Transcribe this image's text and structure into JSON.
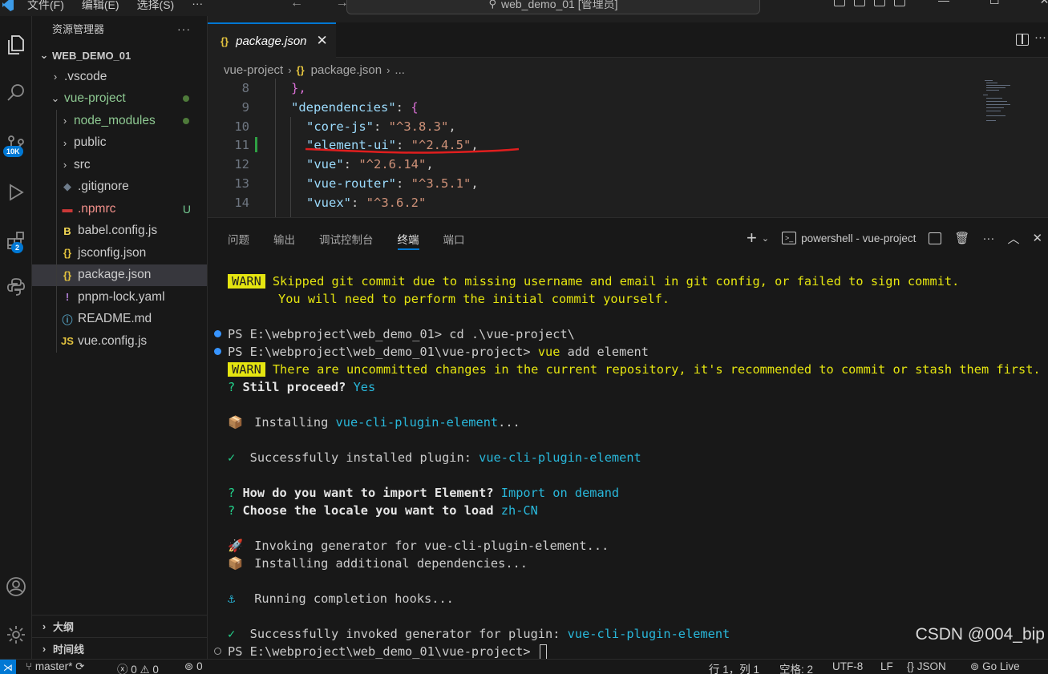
{
  "titlebar": {
    "menu": [
      "文件(F)",
      "编辑(E)",
      "选择(S)",
      "···"
    ],
    "nav": "← →",
    "search_text": "web_demo_01 [管理员]"
  },
  "activitybar": {
    "scm_badge": "10K",
    "extensions_badge": "2"
  },
  "sidebar": {
    "title": "资源管理器",
    "more": "···",
    "workspace": "WEB_DEMO_01",
    "tree": [
      {
        "label": ".vscode",
        "type": "folder",
        "depth": 1,
        "expanded": false
      },
      {
        "label": "vue-project",
        "type": "folder",
        "depth": 1,
        "expanded": true,
        "status": "dot"
      },
      {
        "label": "node_modules",
        "type": "folder",
        "depth": 2,
        "expanded": false,
        "status": "dot"
      },
      {
        "label": "public",
        "type": "folder",
        "depth": 2,
        "expanded": false
      },
      {
        "label": "src",
        "type": "folder",
        "depth": 2,
        "expanded": false
      },
      {
        "label": ".gitignore",
        "type": "file",
        "icon": "git-icon",
        "depth": 2
      },
      {
        "label": ".npmrc",
        "type": "file",
        "icon": "npm-icon",
        "depth": 2,
        "status": "U"
      },
      {
        "label": "babel.config.js",
        "type": "file",
        "icon": "babel-icon",
        "depth": 2
      },
      {
        "label": "jsconfig.json",
        "type": "file",
        "icon": "json-icon",
        "depth": 2
      },
      {
        "label": "package.json",
        "type": "file",
        "icon": "json-icon",
        "depth": 2,
        "selected": true
      },
      {
        "label": "pnpm-lock.yaml",
        "type": "file",
        "icon": "yaml-icon",
        "depth": 2
      },
      {
        "label": "README.md",
        "type": "file",
        "icon": "info-icon",
        "depth": 2
      },
      {
        "label": "vue.config.js",
        "type": "file",
        "icon": "js-icon",
        "depth": 2
      }
    ],
    "outline": "大纲",
    "timeline": "时间线"
  },
  "editor": {
    "tab_label": "package.json",
    "tab_icon": "{}",
    "breadcrumb": [
      "vue-project",
      "package.json",
      "..."
    ],
    "lines": [
      {
        "n": "8",
        "tokens": [
          {
            "t": "},",
            "k": "brace-y"
          }
        ]
      },
      {
        "n": "9",
        "tokens": [
          {
            "t": "\"dependencies\"",
            "k": "str-key"
          },
          {
            "t": ": ",
            "k": "punct"
          },
          {
            "t": "{",
            "k": "brace-y"
          }
        ]
      },
      {
        "n": "10",
        "tokens": [
          {
            "t": "\"core-js\"",
            "k": "str-key"
          },
          {
            "t": ": ",
            "k": "punct"
          },
          {
            "t": "\"^3.8.3\"",
            "k": "str-val"
          },
          {
            "t": ",",
            "k": "punct"
          }
        ]
      },
      {
        "n": "11",
        "tokens": [
          {
            "t": "\"element-ui\"",
            "k": "str-key"
          },
          {
            "t": ": ",
            "k": "punct"
          },
          {
            "t": "\"^2.4.5\"",
            "k": "str-val"
          },
          {
            "t": ",",
            "k": "punct"
          }
        ]
      },
      {
        "n": "12",
        "tokens": [
          {
            "t": "\"vue\"",
            "k": "str-key"
          },
          {
            "t": ": ",
            "k": "punct"
          },
          {
            "t": "\"^2.6.14\"",
            "k": "str-val"
          },
          {
            "t": ",",
            "k": "punct"
          }
        ]
      },
      {
        "n": "13",
        "tokens": [
          {
            "t": "\"vue-router\"",
            "k": "str-key"
          },
          {
            "t": ": ",
            "k": "punct"
          },
          {
            "t": "\"^3.5.1\"",
            "k": "str-val"
          },
          {
            "t": ",",
            "k": "punct"
          }
        ]
      },
      {
        "n": "14",
        "tokens": [
          {
            "t": "\"vuex\"",
            "k": "str-key"
          },
          {
            "t": ": ",
            "k": "punct"
          },
          {
            "t": "\"^3.6.2\"",
            "k": "str-val"
          }
        ]
      }
    ]
  },
  "panel": {
    "tabs": [
      "问题",
      "输出",
      "调试控制台",
      "终端",
      "端口"
    ],
    "active_tab": "终端",
    "terminal_name": "powershell - vue-project",
    "terminal": {
      "warn_badge": "WARN",
      "warn1_line1": "Skipped git commit due to missing username and email in git config, or failed to sign commit.",
      "warn1_line2": "You will need to perform the initial commit yourself.",
      "prompt1": "PS E:\\webproject\\web_demo_01> ",
      "cmd1": "cd .\\vue-project\\",
      "prompt2": "PS E:\\webproject\\web_demo_01\\vue-project> ",
      "cmd2_bin": "vue",
      "cmd2_args": " add element",
      "warn2": "There are uncommitted changes in the current repository, it's recommended to commit or stash them first.",
      "q_mark": "?",
      "proceed_q": "Still proceed?",
      "proceed_a": "Yes",
      "installing_emoji": "📦",
      "installing_text": "Installing ",
      "installing_pkg": "vue-cli-plugin-element",
      "installing_ellipsis": "...",
      "check": "✓",
      "installed_text": "Successfully installed plugin: ",
      "installed_pkg": "vue-cli-plugin-element",
      "import_q": "How do you want to import Element?",
      "import_a": "Import on demand",
      "locale_q": "Choose the locale you want to load",
      "locale_a": "zh-CN",
      "rocket": "🚀",
      "invoking": "Invoking generator for vue-cli-plugin-element...",
      "installing_deps": "Installing additional dependencies...",
      "anchor": "⚓",
      "hooks": "Running completion hooks...",
      "invoked_text": "Successfully invoked generator for plugin: ",
      "invoked_pkg": "vue-cli-plugin-element",
      "prompt3": "PS E:\\webproject\\web_demo_01\\vue-project> "
    },
    "watermark": "CSDN @004_bip"
  },
  "statusbar": {
    "branch": "master*",
    "errors": "0",
    "warnings": "0",
    "ports": "0",
    "position": "行 1，列 1",
    "spaces": "空格: 2",
    "encoding": "UTF-8",
    "eol": "LF",
    "language": "{} JSON",
    "golive": "Go Live"
  },
  "colors": {
    "accent": "#0078d4",
    "warn_bg": "#e5e510",
    "term_cyan": "#29b8db",
    "term_green": "#23d18b",
    "json_key": "#9cdcfe",
    "json_value": "#ce9178",
    "annotation_red": "#e01e1e"
  }
}
